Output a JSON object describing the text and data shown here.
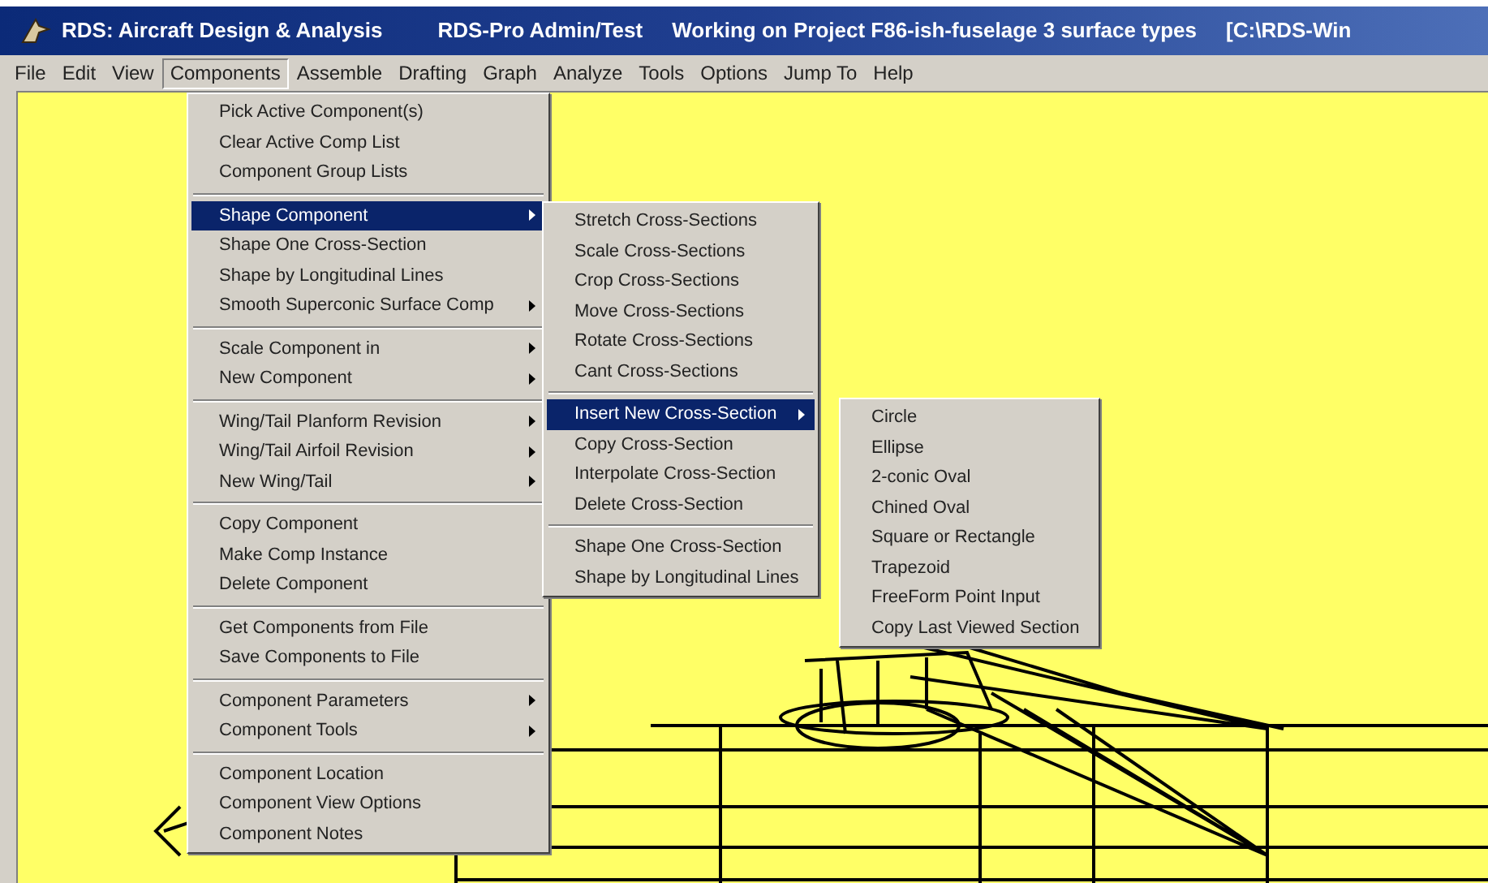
{
  "window": {
    "title_parts": [
      "RDS: Aircraft Design & Analysis",
      "RDS-Pro Admin/Test",
      "Working on Project  F86-ish-fuselage 3 surface types",
      "[C:\\RDS-Win"
    ]
  },
  "menu_bar": [
    {
      "label": "File",
      "selected": false
    },
    {
      "label": "Edit",
      "selected": false
    },
    {
      "label": "View",
      "selected": false
    },
    {
      "label": "Components",
      "selected": true
    },
    {
      "label": "Assemble",
      "selected": false
    },
    {
      "label": "Drafting",
      "selected": false
    },
    {
      "label": "Graph",
      "selected": false
    },
    {
      "label": "Analyze",
      "selected": false
    },
    {
      "label": "Tools",
      "selected": false
    },
    {
      "label": "Options",
      "selected": false
    },
    {
      "label": "Jump To",
      "selected": false
    },
    {
      "label": "Help",
      "selected": false
    }
  ],
  "menus": [
    {
      "groups": [
        [
          {
            "label": "Pick Active Component(s)",
            "submenu": false,
            "selected": false
          },
          {
            "label": "Clear Active Comp List",
            "submenu": false,
            "selected": false
          },
          {
            "label": "Component Group Lists",
            "submenu": false,
            "selected": false
          }
        ],
        [
          {
            "label": "Shape Component",
            "submenu": true,
            "selected": true
          },
          {
            "label": "Shape One Cross-Section",
            "submenu": false,
            "selected": false
          },
          {
            "label": "Shape by Longitudinal Lines",
            "submenu": false,
            "selected": false
          },
          {
            "label": "Smooth Superconic Surface Comp",
            "submenu": true,
            "selected": false
          }
        ],
        [
          {
            "label": "Scale Component in",
            "submenu": true,
            "selected": false
          },
          {
            "label": "New Component",
            "submenu": true,
            "selected": false
          }
        ],
        [
          {
            "label": "Wing/Tail Planform Revision",
            "submenu": true,
            "selected": false
          },
          {
            "label": "Wing/Tail Airfoil Revision",
            "submenu": true,
            "selected": false
          },
          {
            "label": "New Wing/Tail",
            "submenu": true,
            "selected": false
          }
        ],
        [
          {
            "label": "Copy Component",
            "submenu": false,
            "selected": false
          },
          {
            "label": "Make Comp Instance",
            "submenu": false,
            "selected": false
          },
          {
            "label": "Delete Component",
            "submenu": false,
            "selected": false
          }
        ],
        [
          {
            "label": "Get Components from File",
            "submenu": false,
            "selected": false
          },
          {
            "label": "Save Components to File",
            "submenu": false,
            "selected": false
          }
        ],
        [
          {
            "label": "Component Parameters",
            "submenu": true,
            "selected": false
          },
          {
            "label": "Component Tools",
            "submenu": true,
            "selected": false
          }
        ],
        [
          {
            "label": "Component Location",
            "submenu": false,
            "selected": false
          },
          {
            "label": "Component View Options",
            "submenu": false,
            "selected": false
          },
          {
            "label": "Component Notes",
            "submenu": false,
            "selected": false
          }
        ]
      ]
    },
    {
      "groups": [
        [
          {
            "label": "Stretch Cross-Sections",
            "submenu": false,
            "selected": false
          },
          {
            "label": "Scale Cross-Sections",
            "submenu": false,
            "selected": false
          },
          {
            "label": "Crop Cross-Sections",
            "submenu": false,
            "selected": false
          },
          {
            "label": "Move Cross-Sections",
            "submenu": false,
            "selected": false
          },
          {
            "label": "Rotate Cross-Sections",
            "submenu": false,
            "selected": false
          },
          {
            "label": "Cant Cross-Sections",
            "submenu": false,
            "selected": false
          }
        ],
        [
          {
            "label": "Insert New Cross-Section",
            "submenu": true,
            "selected": true
          },
          {
            "label": "Copy Cross-Section",
            "submenu": false,
            "selected": false
          },
          {
            "label": "Interpolate Cross-Section",
            "submenu": false,
            "selected": false
          },
          {
            "label": "Delete Cross-Section",
            "submenu": false,
            "selected": false
          }
        ],
        [
          {
            "label": "Shape One Cross-Section",
            "submenu": false,
            "selected": false
          },
          {
            "label": "Shape by Longitudinal Lines",
            "submenu": false,
            "selected": false
          }
        ]
      ]
    },
    {
      "groups": [
        [
          {
            "label": "Circle",
            "submenu": false,
            "selected": false
          },
          {
            "label": "Ellipse",
            "submenu": false,
            "selected": false
          },
          {
            "label": "2-conic Oval",
            "submenu": false,
            "selected": false
          },
          {
            "label": "Chined Oval",
            "submenu": false,
            "selected": false
          },
          {
            "label": "Square or Rectangle",
            "submenu": false,
            "selected": false
          },
          {
            "label": "Trapezoid",
            "submenu": false,
            "selected": false
          },
          {
            "label": "FreeForm Point Input",
            "submenu": false,
            "selected": false
          },
          {
            "label": "Copy Last Viewed Section",
            "submenu": false,
            "selected": false
          }
        ]
      ]
    }
  ]
}
